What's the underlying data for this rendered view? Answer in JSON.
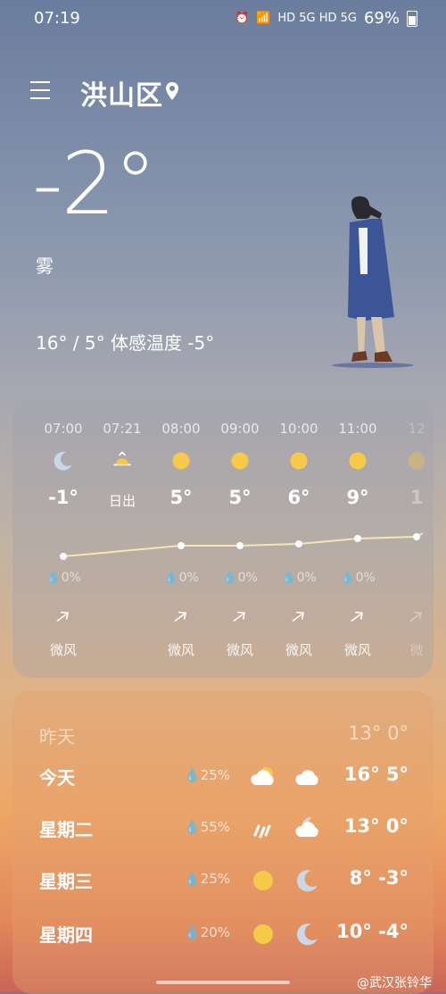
{
  "status_bar": {
    "time": "07:19",
    "network": "HD 5G HD 5G",
    "battery": "69%"
  },
  "header": {
    "city": "洪山区"
  },
  "current": {
    "temperature": "-2°",
    "condition": "雾",
    "summary": "16° / 5° 体感温度 -5°"
  },
  "hourly": [
    {
      "time": "07:00",
      "icon": "moon-icon",
      "temp": "-1°",
      "precip": "0%",
      "wind": "微风",
      "wind_icon": "arrow-ne-icon"
    },
    {
      "time": "07:21",
      "icon": "sunrise-icon",
      "temp": "日出",
      "precip": "",
      "wind": "",
      "wind_icon": ""
    },
    {
      "time": "08:00",
      "icon": "sun-icon",
      "temp": "5°",
      "precip": "0%",
      "wind": "微风",
      "wind_icon": "arrow-ne-icon"
    },
    {
      "time": "09:00",
      "icon": "sun-icon",
      "temp": "5°",
      "precip": "0%",
      "wind": "微风",
      "wind_icon": "arrow-ne-icon"
    },
    {
      "time": "10:00",
      "icon": "sun-icon",
      "temp": "6°",
      "precip": "0%",
      "wind": "微风",
      "wind_icon": "arrow-ne-icon"
    },
    {
      "time": "11:00",
      "icon": "sun-icon",
      "temp": "9°",
      "precip": "0%",
      "wind": "微风",
      "wind_icon": "arrow-ne-icon"
    },
    {
      "time": "12",
      "icon": "sun-icon",
      "temp": "1",
      "precip": "",
      "wind": "微",
      "wind_icon": "arrow-ne-icon"
    }
  ],
  "daily": [
    {
      "day": "昨天",
      "precip": "",
      "icon_day": "",
      "icon_night": "",
      "temps": "13°  0°"
    },
    {
      "day": "今天",
      "precip": "25%",
      "icon_day": "partly-cloudy-icon",
      "icon_night": "cloud-icon",
      "temps": "16°  5°"
    },
    {
      "day": "星期二",
      "precip": "55%",
      "icon_day": "rain-icon",
      "icon_night": "cloudy-moon-icon",
      "temps": "13°  0°"
    },
    {
      "day": "星期三",
      "precip": "25%",
      "icon_day": "sun-icon",
      "icon_night": "moon-icon",
      "temps": "8°  -3°"
    },
    {
      "day": "星期四",
      "precip": "20%",
      "icon_day": "sun-icon",
      "icon_night": "moon-icon",
      "temps": "10°  -4°"
    }
  ],
  "watermark": "@武汉张铃华",
  "colors": {
    "sun": "#f7c948",
    "moon": "#c9d8e8",
    "curve": "#f4e6b0"
  }
}
